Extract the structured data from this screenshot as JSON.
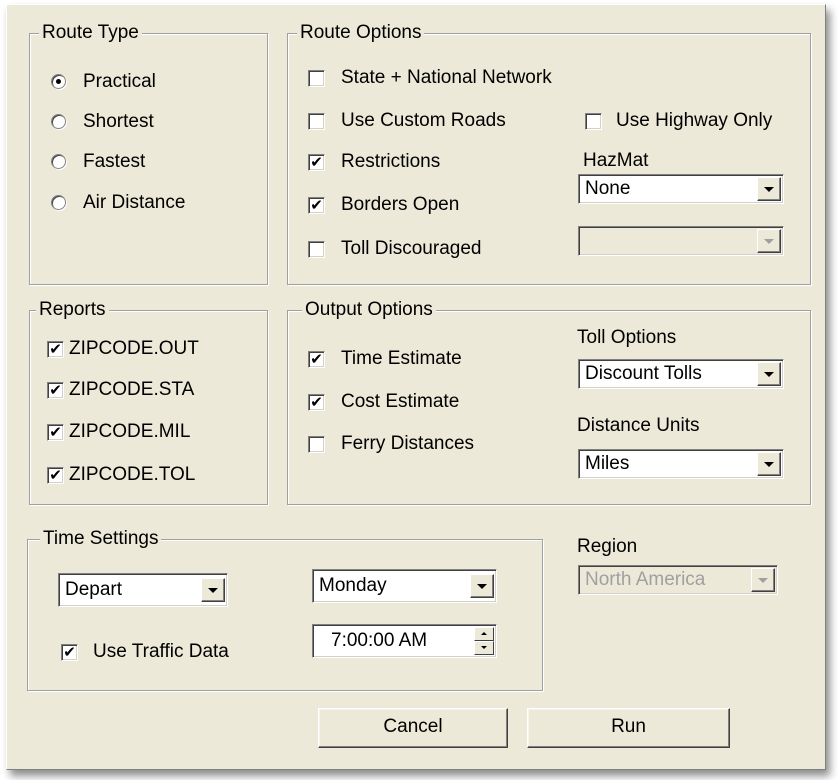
{
  "route_type": {
    "title": "Route Type",
    "options": [
      {
        "label": "Practical",
        "selected": true
      },
      {
        "label": "Shortest",
        "selected": false
      },
      {
        "label": "Fastest",
        "selected": false
      },
      {
        "label": "Air Distance",
        "selected": false
      }
    ]
  },
  "route_options": {
    "title": "Route Options",
    "state_national_network": {
      "label": "State + National Network",
      "checked": false
    },
    "use_custom_roads": {
      "label": "Use Custom Roads",
      "checked": false
    },
    "use_highway_only": {
      "label": "Use Highway Only",
      "checked": false
    },
    "restrictions": {
      "label": "Restrictions",
      "checked": true
    },
    "borders_open": {
      "label": "Borders Open",
      "checked": true
    },
    "toll_discouraged": {
      "label": "Toll Discouraged",
      "checked": false
    },
    "hazmat": {
      "label": "HazMat",
      "value": "None"
    },
    "secondary_select": {
      "value": "",
      "disabled": true
    }
  },
  "reports": {
    "title": "Reports",
    "items": [
      {
        "label": "ZIPCODE.OUT",
        "checked": true
      },
      {
        "label": "ZIPCODE.STA",
        "checked": true
      },
      {
        "label": "ZIPCODE.MIL",
        "checked": true
      },
      {
        "label": "ZIPCODE.TOL",
        "checked": true
      }
    ]
  },
  "output_options": {
    "title": "Output Options",
    "time_estimate": {
      "label": "Time Estimate",
      "checked": true
    },
    "cost_estimate": {
      "label": "Cost Estimate",
      "checked": true
    },
    "ferry_distances": {
      "label": "Ferry Distances",
      "checked": false
    },
    "toll_options": {
      "label": "Toll Options",
      "value": "Discount Tolls"
    },
    "distance_units": {
      "label": "Distance Units",
      "value": "Miles"
    }
  },
  "time_settings": {
    "title": "Time Settings",
    "depart_select": "Depart",
    "day_select": "Monday",
    "use_traffic_data": {
      "label": "Use Traffic Data",
      "checked": true
    },
    "time_value": "7:00:00 AM"
  },
  "region": {
    "label": "Region",
    "value": "North America",
    "disabled": true
  },
  "buttons": {
    "cancel": "Cancel",
    "run": "Run"
  },
  "glyphs": {
    "check": "✔"
  }
}
